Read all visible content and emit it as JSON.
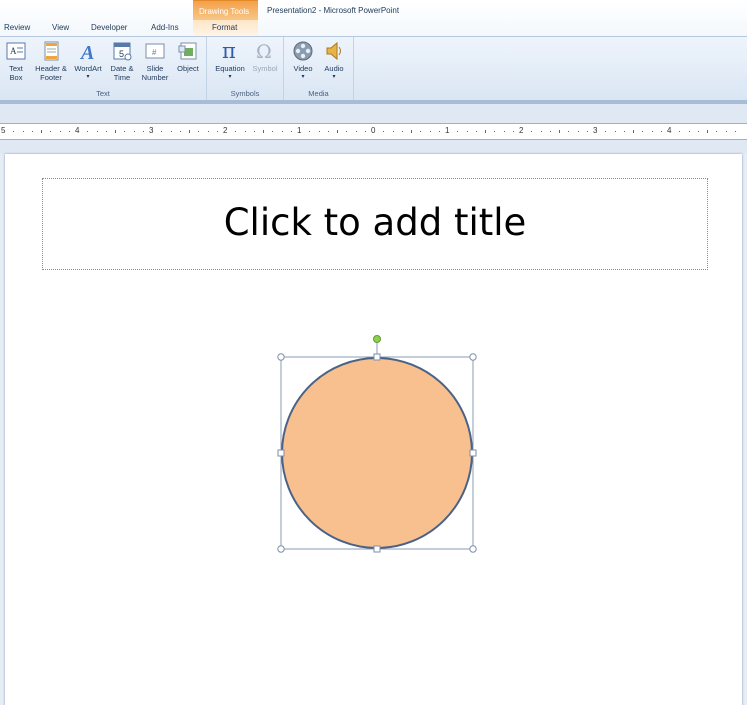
{
  "window": {
    "context_group": "Drawing Tools",
    "title": "Presentation2 - Microsoft PowerPoint"
  },
  "tabs": [
    {
      "label": "Review"
    },
    {
      "label": "View"
    },
    {
      "label": "Developer"
    },
    {
      "label": "Add-Ins"
    },
    {
      "label": "Format"
    }
  ],
  "ribbon": {
    "groups": [
      {
        "label": "Text",
        "buttons": [
          {
            "label": "Text Box",
            "icon": "text-box-icon"
          },
          {
            "label": "Header & Footer",
            "icon": "header-footer-icon"
          },
          {
            "label": "WordArt",
            "icon": "wordart-icon",
            "dropdown": true
          },
          {
            "label": "Date & Time",
            "icon": "date-time-icon"
          },
          {
            "label": "Slide Number",
            "icon": "slide-number-icon"
          },
          {
            "label": "Object",
            "icon": "object-icon"
          }
        ]
      },
      {
        "label": "Symbols",
        "buttons": [
          {
            "label": "Equation",
            "icon": "pi-icon",
            "dropdown": true
          },
          {
            "label": "Symbol",
            "icon": "omega-icon",
            "disabled": true
          }
        ]
      },
      {
        "label": "Media",
        "buttons": [
          {
            "label": "Video",
            "icon": "film-reel-icon",
            "dropdown": true
          },
          {
            "label": "Audio",
            "icon": "speaker-icon",
            "dropdown": true
          }
        ]
      }
    ]
  },
  "ruler": {
    "labels": [
      "5",
      "4",
      "3",
      "2",
      "1",
      "0",
      "1",
      "2",
      "3",
      "4"
    ]
  },
  "slide": {
    "title_placeholder": "Click to add title",
    "shape": {
      "type": "circle",
      "fill": "#f9c08f",
      "stroke": "#4a6286",
      "selected": true,
      "rotation_handle_color": "#8fd14f"
    }
  }
}
